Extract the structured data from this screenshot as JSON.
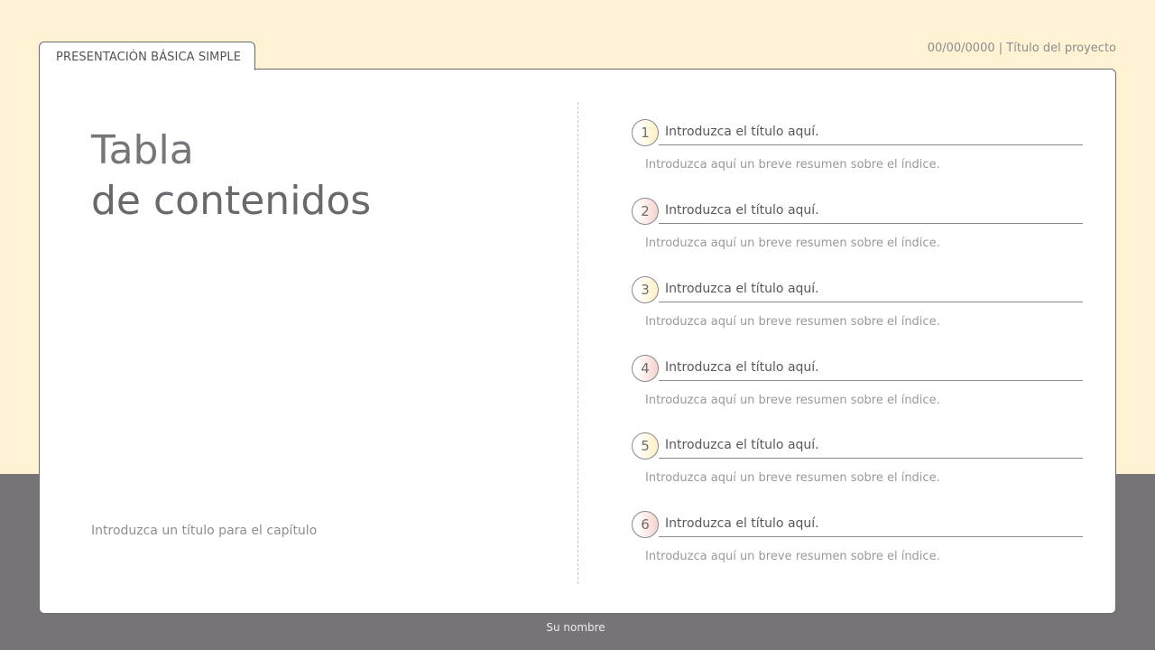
{
  "header": {
    "tab_label": "PRESENTACIÓN BÁSICA SIMPLE",
    "date_project": "00/00/0000 | Título del proyecto"
  },
  "main": {
    "title_line1": "Tabla",
    "title_line2": "de contenidos",
    "chapter_prompt": "Introduzca un título para el capítulo"
  },
  "toc": {
    "items": [
      {
        "num": "1",
        "title": "Introduzca el título aquí.",
        "desc": "Introduzca aquí un breve resumen sobre el índice.",
        "accent": "#FFF0C0"
      },
      {
        "num": "2",
        "title": "Introduzca el título aquí.",
        "desc": "Introduzca aquí un breve resumen sobre el índice.",
        "accent": "#F7D2CB"
      },
      {
        "num": "3",
        "title": "Introduzca el título aquí.",
        "desc": "Introduzca aquí un breve resumen sobre el índice.",
        "accent": "#FFF0C0"
      },
      {
        "num": "4",
        "title": "Introduzca el título aquí.",
        "desc": "Introduzca aquí un breve resumen sobre el índice.",
        "accent": "#F7D2CB"
      },
      {
        "num": "5",
        "title": "Introduzca el título aquí.",
        "desc": "Introduzca aquí un breve resumen sobre el índice.",
        "accent": "#FFF0C0"
      },
      {
        "num": "6",
        "title": "Introduzca el título aquí.",
        "desc": "Introduzca aquí un breve resumen sobre el índice.",
        "accent": "#F7D2CB"
      }
    ]
  },
  "footer": {
    "name": "Su nombre"
  },
  "colors": {
    "background_top": "#FFF3D3",
    "background_bottom": "#767477",
    "card": "#FFFFFF",
    "border": "#6D6B70"
  }
}
